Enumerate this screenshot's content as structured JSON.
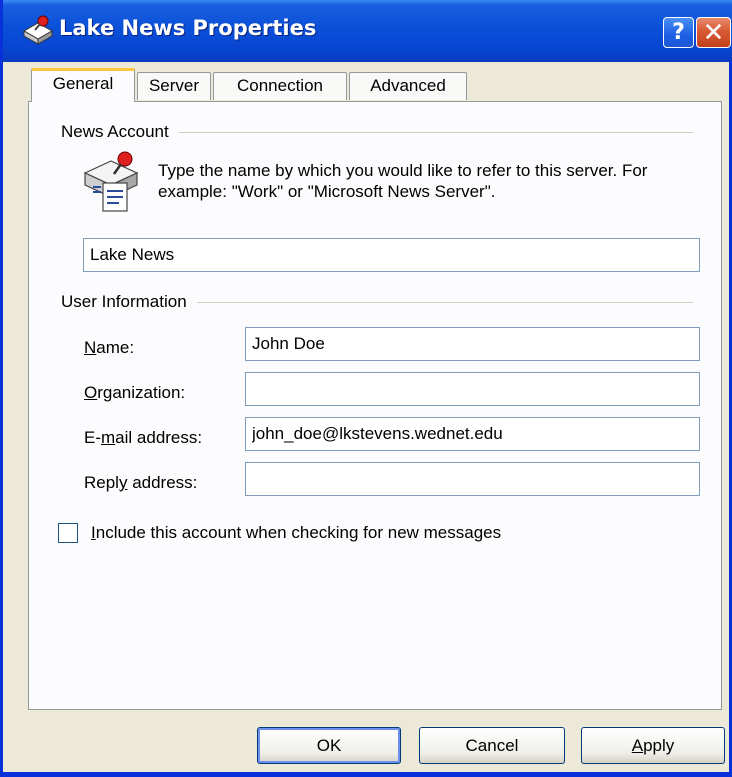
{
  "window": {
    "title": "Lake News Properties",
    "help_label": "?",
    "close_label": "✕"
  },
  "tabs": [
    {
      "label": "General",
      "active": true
    },
    {
      "label": "Server",
      "active": false
    },
    {
      "label": "Connection",
      "active": false
    },
    {
      "label": "Advanced",
      "active": false
    }
  ],
  "news_account": {
    "group_label": "News Account",
    "description": "Type the name by which you would like to refer to this server.  For example: \"Work\" or \"Microsoft News Server\".",
    "account_name": "Lake News"
  },
  "user_information": {
    "group_label": "User Information",
    "name_label": {
      "accel": "N",
      "rest": "ame:"
    },
    "name_value": "John Doe",
    "organization_label": {
      "accel": "O",
      "rest": "rganization:"
    },
    "organization_value": "",
    "email_label": {
      "pre": "E-",
      "accel": "m",
      "rest": "ail address:"
    },
    "email_value": "john_doe@lkstevens.wednet.edu",
    "reply_label": {
      "pre": "Repl",
      "accel": "y",
      "rest": " address:"
    },
    "reply_value": ""
  },
  "include_checkbox": {
    "accel": "I",
    "rest": "nclude this account when checking for new messages",
    "checked": false
  },
  "buttons": {
    "ok": "OK",
    "cancel": "Cancel",
    "apply": {
      "accel": "A",
      "rest": "pply"
    }
  },
  "colors": {
    "titlebar": "#0a50d8",
    "dialog_bg": "#ece9d8",
    "tab_highlight": "#ffc83c",
    "close_button": "#d85a34"
  }
}
